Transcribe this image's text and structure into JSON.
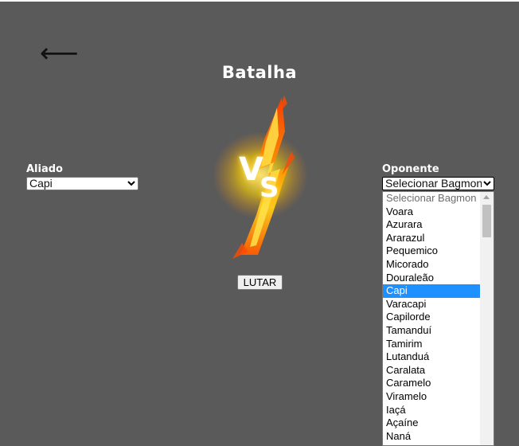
{
  "header": {
    "back_arrow": "⟵",
    "title": "Batalha"
  },
  "ally": {
    "label": "Aliado",
    "selected": "Capi"
  },
  "opponent": {
    "label": "Oponente",
    "selected": "Selecionar Bagmon"
  },
  "vs": {
    "v": "V",
    "s": "S"
  },
  "fight_button": "LUTAR",
  "caret": "⌄",
  "dropdown": {
    "options": [
      "Selecionar Bagmon",
      "Voara",
      "Azurara",
      "Ararazul",
      "Pequemico",
      "Micorado",
      "Douraleão",
      "Capi",
      "Varacapi",
      "Capilorde",
      "Tamanduí",
      "Tamirim",
      "Lutanduá",
      "Caralata",
      "Caramelo",
      "Viramelo",
      "Iaçá",
      "Açaíne",
      "Naná"
    ],
    "highlighted": "Capi"
  },
  "colors": {
    "background": "#5a5a5a",
    "highlight": "#1e90ff",
    "flame_core": "#ffd400",
    "flame_outer": "#ff4a00"
  }
}
